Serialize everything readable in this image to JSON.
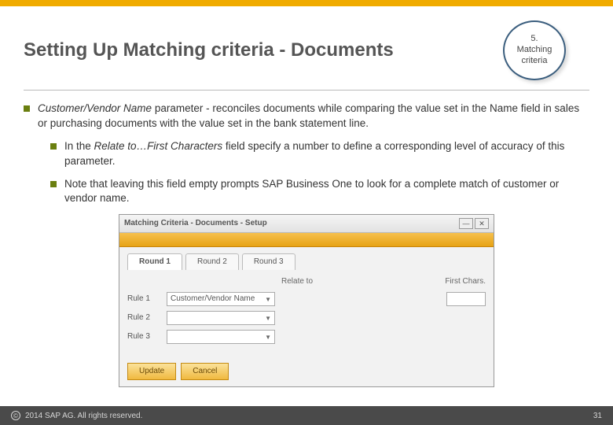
{
  "accent_colors": {
    "sap_gold": "#f0ab00",
    "bullet_green": "#6a7f10",
    "badge_border": "#3b5e7e"
  },
  "header": {
    "title": "Setting Up Matching criteria - Documents",
    "badge_number": "5.",
    "badge_label_line1": "Matching",
    "badge_label_line2": "criteria"
  },
  "bullets": {
    "main_prefix": "Customer/Vendor Name",
    "main_rest": " parameter - reconciles documents while comparing the value set in the Name field in sales or purchasing documents with the value set in the bank statement line.",
    "sub1_prefix": "In the ",
    "sub1_em": "Relate to…First Characters",
    "sub1_rest": " field specify a number to define a corresponding level of accuracy of this parameter.",
    "sub2": "Note that leaving this field empty prompts SAP Business One to look for a complete match of customer or vendor name."
  },
  "window": {
    "title": "Matching Criteria - Documents - Setup",
    "minimize": "—",
    "close": "✕",
    "tabs": [
      "Round 1",
      "Round 2",
      "Round 3"
    ],
    "col_relate": "Relate to",
    "col_first": "First Chars.",
    "rows": [
      {
        "label": "Rule 1",
        "value": "Customer/Vendor Name"
      },
      {
        "label": "Rule 2",
        "value": ""
      },
      {
        "label": "Rule 3",
        "value": ""
      }
    ],
    "buttons": {
      "update": "Update",
      "cancel": "Cancel"
    }
  },
  "footer": {
    "copyright": "2014 SAP AG. All rights reserved.",
    "page": "31"
  }
}
